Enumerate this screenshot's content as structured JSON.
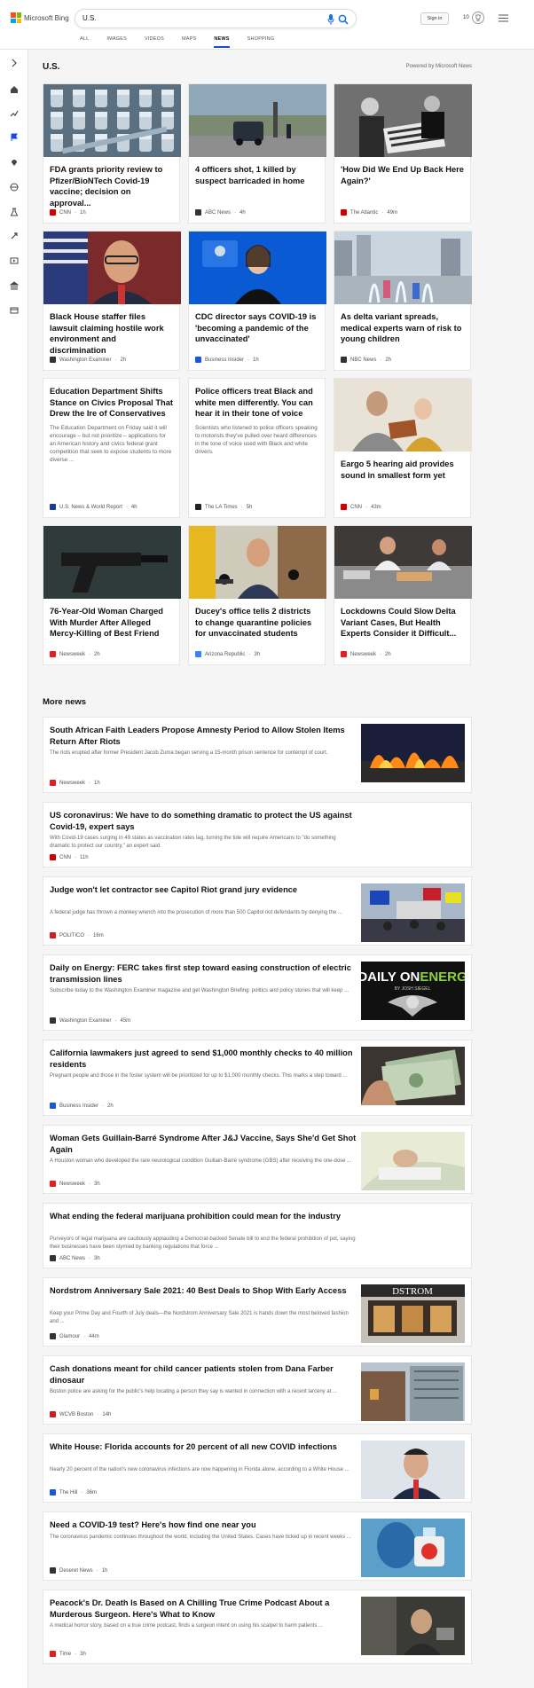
{
  "brand": {
    "name": "Microsoft Bing",
    "colors": [
      "#f25022",
      "#7fba00",
      "#00a4ef",
      "#ffb900"
    ]
  },
  "search": {
    "query": "U.S."
  },
  "scopes": [
    {
      "label": "ALL",
      "active": false
    },
    {
      "label": "IMAGES",
      "active": false
    },
    {
      "label": "VIDEOS",
      "active": false
    },
    {
      "label": "MAPS",
      "active": false
    },
    {
      "label": "NEWS",
      "active": true
    },
    {
      "label": "SHOPPING",
      "active": false
    }
  ],
  "header": {
    "signin_label": "Sign in",
    "rewards_count": "10"
  },
  "sidebar": {
    "icons": [
      "expand-icon",
      "home-icon",
      "trending-icon",
      "flag-icon",
      "location-icon",
      "globe-icon",
      "science-icon",
      "rocket-icon",
      "film-icon",
      "bank-icon",
      "card-icon"
    ]
  },
  "main": {
    "section_title": "U.S.",
    "powered_by": "Powered by Microsoft News",
    "cards": [
      {
        "title": "FDA grants priority review to Pfizer/BioNTech Covid-19 vaccine; decision on approval...",
        "snippet": "",
        "source": "CNN",
        "time": "1h",
        "has_image": true,
        "image": "vials",
        "source_color": "#cc0000"
      },
      {
        "title": "4 officers shot, 1 killed by suspect barricaded in home",
        "snippet": "",
        "source": "ABC News",
        "time": "4h",
        "has_image": true,
        "image": "police",
        "source_color": "#333333"
      },
      {
        "title": "'How Did We End Up Back Here Again?'",
        "snippet": "",
        "source": "The Atlantic",
        "time": "49m",
        "has_image": true,
        "image": "bw",
        "source_color": "#cc0000"
      },
      {
        "title": "Black House staffer files lawsuit claiming hostile work environment and discrimination",
        "snippet": "",
        "source": "Washington Examiner",
        "time": "2h",
        "has_image": true,
        "image": "man",
        "source_color": "#333333"
      },
      {
        "title": "CDC director says COVID-19 is 'becoming a pandemic of the unvaccinated'",
        "snippet": "",
        "source": "Business Insider",
        "time": "1h",
        "has_image": true,
        "image": "cdc",
        "source_color": "#1a56db"
      },
      {
        "title": "As delta variant spreads, medical experts warn of risk to young children",
        "snippet": "",
        "source": "NBC News",
        "time": "2h",
        "has_image": true,
        "image": "fountain",
        "source_color": "#333333"
      },
      {
        "title": "Education Department Shifts Stance on Civics Proposal That Drew the Ire of Conservatives",
        "snippet": "The Education Department on Friday said it will encourage – but not prioritize – applications for an American history and civics federal grant competition that seek to expose students to more diverse ...",
        "source": "U.S. News & World Report",
        "time": "4h",
        "has_image": false,
        "image": "",
        "source_color": "#1a3e8c"
      },
      {
        "title": "Police officers treat Black and white men differently. You can hear it in their tone of voice",
        "snippet": "Scientists who listened to police officers speaking to motorists they've pulled over heard differences in the tone of voice used with Black and white drivers.",
        "source": "The LA Times",
        "time": "5h",
        "has_image": false,
        "image": "",
        "source_color": "#222222"
      },
      {
        "title": "Eargo 5 hearing aid provides sound in smallest form yet",
        "snippet": "",
        "source": "CNN",
        "time": "43m",
        "has_image": true,
        "image": "reading",
        "source_color": "#cc0000"
      },
      {
        "title": "76-Year-Old Woman Charged With Murder After Alleged Mercy-Killing of Best Friend",
        "snippet": "",
        "source": "Newsweek",
        "time": "2h",
        "has_image": true,
        "image": "gun",
        "source_color": "#e02020"
      },
      {
        "title": "Ducey's office tells 2 districts to change quarantine policies for unvaccinated students",
        "snippet": "",
        "source": "Arizona Republic",
        "time": "3h",
        "has_image": true,
        "image": "press",
        "source_color": "#3b82f6"
      },
      {
        "title": "Lockdowns Could Slow Delta Variant Cases, But Health Experts Consider it Difficult...",
        "snippet": "",
        "source": "Newsweek",
        "time": "2h",
        "has_image": true,
        "image": "kitchen",
        "source_color": "#e02020"
      }
    ],
    "more_news_title": "More news",
    "more_news": [
      {
        "title": "South African Faith Leaders Propose Amnesty Period to Allow Stolen Items Return After Riots",
        "snippet": "The riots erupted after former President Jacob Zuma began serving a 15-month prison sentence for contempt of court.",
        "source": "Newsweek",
        "time": "1h",
        "thumb": "fire",
        "source_color": "#e02020"
      },
      {
        "title": "US coronavirus: We have to do something dramatic to protect the US against Covid-19, expert says",
        "snippet": "With Covid-19 cases surging in 49 states as vaccination rates lag, turning the tide will require Americans to \"do something dramatic to protect our country,\" an expert said.",
        "source": "CNN",
        "time": "11h",
        "thumb": "",
        "source_color": "#cc0000"
      },
      {
        "title": "Judge won't let contractor see Capitol Riot grand jury evidence",
        "snippet": "A federal judge has thrown a monkey wrench into the prosecution of more than 500 Capitol riot defendants by denying the ...",
        "source": "POLITICO",
        "time": "16m",
        "thumb": "capitol",
        "source_color": "#cc1f1f"
      },
      {
        "title": "Daily on Energy: FERC takes first step toward easing construction of electric transmission lines",
        "snippet": "Subscribe today to the Washington Examiner magazine and get Washington Briefing: politics and policy stories that will keep ...",
        "source": "Washington Examiner",
        "time": "45m",
        "thumb": "energy",
        "thumb_text_1": "DAILY ON",
        "thumb_text_2": "ENERG",
        "thumb_text_3": "BY JOSH SIEGEL",
        "source_color": "#333333"
      },
      {
        "title": "California lawmakers just agreed to send $1,000 monthly checks to 40 million residents",
        "snippet": "Pregnant people and those in the foster system will be prioritized for up to $1,000 monthly checks. This marks a step toward ...",
        "source": "Business Insider",
        "time": "2h",
        "thumb": "money",
        "source_color": "#1a56db"
      },
      {
        "title": "Woman Gets Guillain-Barré Syndrome After J&J Vaccine, Says She'd Get Shot Again",
        "snippet": "A Houston woman who developed the rare neurological condition Guillain-Barré syndrome (GBS) after receiving the one-dose ...",
        "source": "Newsweek",
        "time": "3h",
        "thumb": "hospital",
        "source_color": "#e02020"
      },
      {
        "title": "What ending the federal marijuana prohibition could mean for the industry",
        "snippet": "Purveyors of legal marijuana are cautiously applauding a Democrat-backed Senate bill to end the federal prohibition of pot, saying their businesses have been stymied by banking regulations that force ...",
        "source": "ABC News",
        "time": "3h",
        "thumb": "",
        "source_color": "#333333"
      },
      {
        "title": "Nordstrom Anniversary Sale 2021: 40 Best Deals to Shop With Early Access",
        "snippet": "Keep your Prime Day and Fourth of July deals—the Nordstrom Anniversary Sale 2021 is hands down the most beloved fashion and ...",
        "source": "Glamour",
        "time": "44m",
        "thumb": "store",
        "thumb_text_1": "DSTROM",
        "source_color": "#333333"
      },
      {
        "title": "Cash donations meant for child cancer patients stolen from Dana Farber dinosaur",
        "snippet": "Boston police are asking for the public's help locating a person they say is wanted in connection with a recent larceny at ...",
        "source": "WCVB Boston",
        "time": "14h",
        "thumb": "building",
        "source_color": "#cc1f1f"
      },
      {
        "title": "White House: Florida accounts for 20 percent of all new COVID infections",
        "snippet": "Nearly 20 percent of the nation's new coronavirus infections are now happening in Florida alone, according to a White House ...",
        "source": "The Hill",
        "time": "36m",
        "thumb": "desantis",
        "source_color": "#1a56db"
      },
      {
        "title": "Need a COVID-19 test? Here's how find one near you",
        "snippet": "The coronavirus pandemic continues throughout the world, including the United States. Cases have ticked up in recent weeks ...",
        "source": "Deseret News",
        "time": "1h",
        "thumb": "test",
        "source_color": "#333333"
      },
      {
        "title": "Peacock's Dr. Death Is Based on A Chilling True Crime Podcast About a Murderous Surgeon. Here's What to Know",
        "snippet": "A medical horror story, based on a true crime podcast, finds a surgeon intent on using his scalpel to harm patients ...",
        "source": "Time",
        "time": "3h",
        "thumb": "drdeath",
        "source_color": "#e02020"
      }
    ]
  }
}
